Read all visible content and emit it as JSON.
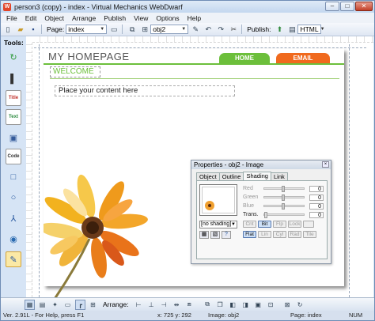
{
  "window": {
    "title": "person3 (copy) - index - Virtual Mechanics WebDwarf",
    "minimize_glyph": "–",
    "maximize_glyph": "□",
    "close_glyph": "✕"
  },
  "menu": [
    "File",
    "Edit",
    "Object",
    "Arrange",
    "Publish",
    "View",
    "Options",
    "Help"
  ],
  "toolbar": {
    "page_label": "Page:",
    "page_value": "index",
    "object_value": "obj2",
    "publish_label": "Publish:",
    "publish_format": "HTML"
  },
  "tools": {
    "label": "Tools:",
    "items": [
      {
        "name": "tool-swirl-icon",
        "glyph": "↻",
        "color": "#2f9a3a"
      },
      {
        "name": "tool-pointer-icon",
        "glyph": "▌",
        "color": "#333"
      },
      {
        "name": "tool-title-icon",
        "glyph": "Title",
        "color": "#c0302a"
      },
      {
        "name": "tool-text-icon",
        "glyph": "Text",
        "color": "#2b8a3e"
      },
      {
        "name": "tool-image-icon",
        "glyph": "▣",
        "color": "#355b9a"
      },
      {
        "name": "tool-code-icon",
        "glyph": "Code",
        "color": "#333"
      },
      {
        "name": "tool-rectangle-icon",
        "glyph": "□",
        "color": "#2a5aa0"
      },
      {
        "name": "tool-circle-icon",
        "glyph": "○",
        "color": "#2a5aa0"
      },
      {
        "name": "tool-polygon-icon",
        "glyph": "⅄",
        "color": "#2a5aa0"
      },
      {
        "name": "tool-globe-icon",
        "glyph": "◉",
        "color": "#2a6ab0"
      },
      {
        "name": "tool-edit-icon",
        "glyph": "✎",
        "color": "#2a5aa0"
      }
    ]
  },
  "page": {
    "title": "MY HOMEPAGE",
    "nav_home": "HOME",
    "nav_email": "EMAIL",
    "welcome": "WELCOME",
    "content_placeholder": "Place your content here"
  },
  "properties": {
    "title": "Properties - obj2 - Image",
    "tabs": [
      "Object",
      "Outline",
      "Shading",
      "Link"
    ],
    "active_tab": "Shading",
    "sliders": [
      {
        "label": "Red",
        "value": "0"
      },
      {
        "label": "Green",
        "value": "0"
      },
      {
        "label": "Blue",
        "value": "0"
      },
      {
        "label": "Trans.",
        "value": "0"
      }
    ],
    "shading_select": "[no shading]",
    "row1_buttons": [
      "Cnt",
      "Bit",
      "Flp",
      "Lock"
    ],
    "row2_buttons": [
      "Flat",
      "Lin",
      "Cyl",
      "Rad",
      "Tile"
    ]
  },
  "bottombar": {
    "arrange_label": "Arrange:"
  },
  "status": {
    "version": "Ver. 2.91L  - For Help, press F1",
    "coords": "x: 725  y: 292",
    "image": "Image: obj2",
    "page": "Page:  index",
    "num": "NUM"
  }
}
